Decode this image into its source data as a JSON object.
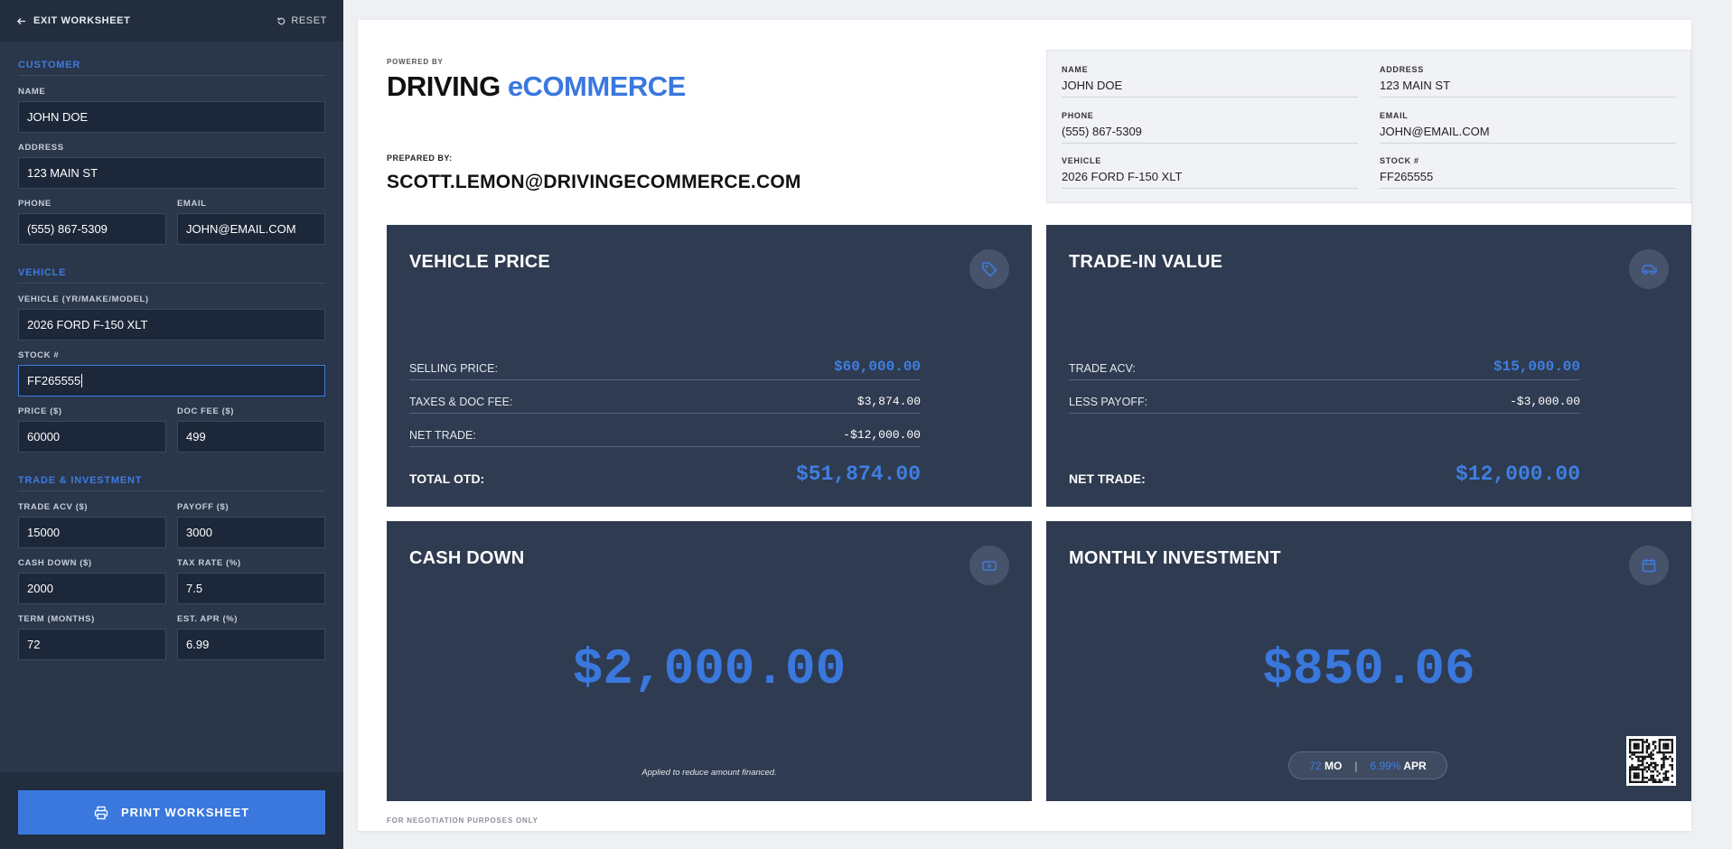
{
  "sidebar": {
    "exit_label": "EXIT WORKSHEET",
    "reset_label": "RESET",
    "sections": {
      "customer": "CUSTOMER",
      "vehicle": "VEHICLE",
      "trade": "TRADE & INVESTMENT"
    },
    "fields": {
      "name": {
        "label": "NAME",
        "value": "JOHN DOE"
      },
      "address": {
        "label": "ADDRESS",
        "value": "123 MAIN ST"
      },
      "phone": {
        "label": "PHONE",
        "value": "(555) 867-5309"
      },
      "email": {
        "label": "EMAIL",
        "value": "JOHN@EMAIL.COM"
      },
      "vehicle": {
        "label": "VEHICLE (YR/MAKE/MODEL)",
        "value": "2026 FORD F-150 XLT"
      },
      "stock": {
        "label": "STOCK #",
        "value": "FF265555"
      },
      "price": {
        "label": "PRICE ($)",
        "value": "60000"
      },
      "doc_fee": {
        "label": "DOC FEE ($)",
        "value": "499"
      },
      "trade_acv": {
        "label": "TRADE ACV ($)",
        "value": "15000"
      },
      "payoff": {
        "label": "PAYOFF ($)",
        "value": "3000"
      },
      "cash_down": {
        "label": "CASH DOWN ($)",
        "value": "2000"
      },
      "tax_rate": {
        "label": "TAX RATE (%)",
        "value": "7.5"
      },
      "term": {
        "label": "TERM (MONTHS)",
        "value": "72"
      },
      "apr": {
        "label": "EST. APR (%)",
        "value": "6.99"
      }
    },
    "print_label": "PRINT WORKSHEET"
  },
  "header": {
    "powered_by": "POWERED BY",
    "logo_part1": "DRIVING",
    "logo_part2": "eCOMMERCE",
    "prepared_label": "PREPARED BY:",
    "prepared_value": "SCOTT.LEMON@DRIVINGECOMMERCE.COM"
  },
  "info": {
    "name": {
      "label": "NAME",
      "value": "JOHN DOE"
    },
    "address": {
      "label": "ADDRESS",
      "value": "123 MAIN ST"
    },
    "phone": {
      "label": "PHONE",
      "value": "(555) 867-5309"
    },
    "email": {
      "label": "EMAIL",
      "value": "JOHN@EMAIL.COM"
    },
    "vehicle": {
      "label": "VEHICLE",
      "value": "2026 FORD F-150 XLT"
    },
    "stock": {
      "label": "STOCK #",
      "value": "FF265555"
    }
  },
  "vehicle_price": {
    "title": "VEHICLE PRICE",
    "icon": "tag-icon",
    "rows": [
      {
        "label": "SELLING PRICE:",
        "value": "$60,000.00"
      },
      {
        "label": "TAXES & DOC FEE:",
        "value": "$3,874.00"
      },
      {
        "label": "NET TRADE:",
        "value": "-$12,000.00"
      }
    ],
    "total_label": "TOTAL OTD:",
    "total_value": "$51,874.00"
  },
  "trade_in": {
    "title": "TRADE-IN VALUE",
    "icon": "car-icon",
    "rows": [
      {
        "label": "TRADE ACV:",
        "value": "$15,000.00"
      },
      {
        "label": "LESS PAYOFF:",
        "value": "-$3,000.00"
      }
    ],
    "total_label": "NET TRADE:",
    "total_value": "$12,000.00"
  },
  "cash_down": {
    "title": "CASH DOWN",
    "icon": "cash-icon",
    "amount": "$2,000.00",
    "note": "Applied to reduce amount financed."
  },
  "monthly": {
    "title": "MONTHLY INVESTMENT",
    "icon": "calendar-icon",
    "amount": "$850.06",
    "term_value": "72",
    "term_unit": "MO",
    "separator": "|",
    "apr_value": "6.99%",
    "apr_unit": "APR"
  },
  "disclaimer": "FOR NEGOTIATION PURPOSES ONLY",
  "colors": {
    "accent": "#3a78de",
    "sidebar": "#2a3649",
    "card": "#2f3b50"
  }
}
